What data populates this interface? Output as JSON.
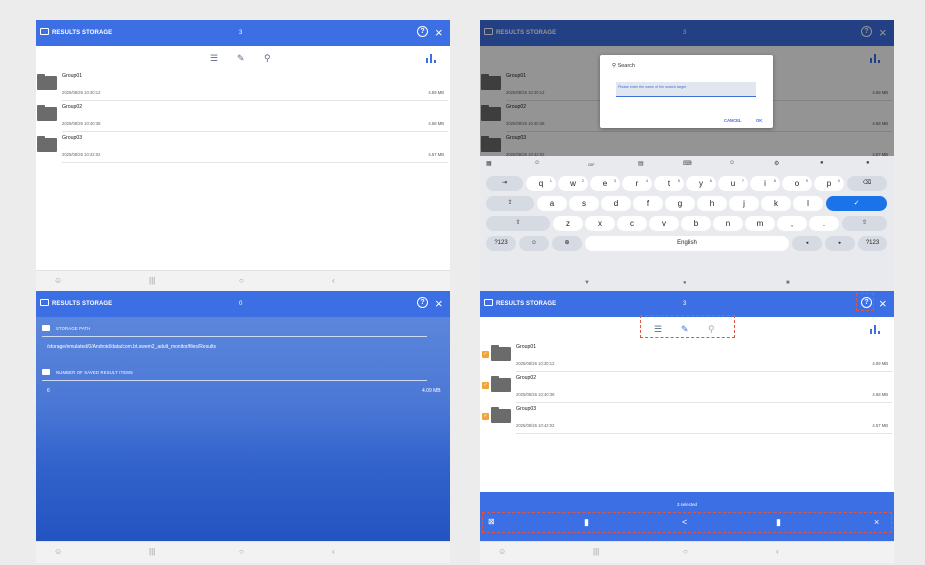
{
  "app": {
    "title": "RESULTS STORAGE",
    "help": "?",
    "close": "×"
  },
  "list_panel": {
    "count": "3",
    "groups": [
      {
        "name": "Group01",
        "date": "2025/08/26 10:30:12",
        "size": "4.59 MB"
      },
      {
        "name": "Group02",
        "date": "2025/08/26 10:40:38",
        "size": "4.58 MB"
      },
      {
        "name": "Group03",
        "date": "2025/08/26 10:42:02",
        "size": "4.57 MB"
      }
    ]
  },
  "search_panel": {
    "count": "3",
    "dialog": {
      "title": "Search",
      "placeholder": "Please enter the name of the search target",
      "cancel": "CANCEL",
      "ok": "OK"
    },
    "groups": [
      {
        "name": "Group01",
        "date": "2025/08/26 10:30:12",
        "size": "4.59 MB"
      },
      {
        "name": "Group02",
        "date": "2025/08/26 10:40:38",
        "size": "4.58 MB"
      },
      {
        "name": "Group03",
        "date": "2025/08/26 10:42:02",
        "size": "4.57 MB"
      }
    ],
    "keyboard": {
      "gif": "GIF",
      "row1": [
        [
          "q",
          "1"
        ],
        [
          "w",
          "2"
        ],
        [
          "e",
          "3"
        ],
        [
          "r",
          "4"
        ],
        [
          "t",
          "5"
        ],
        [
          "y",
          "6"
        ],
        [
          "u",
          "7"
        ],
        [
          "i",
          "8"
        ],
        [
          "o",
          "9"
        ],
        [
          "p",
          "0"
        ]
      ],
      "row2": [
        "a",
        "s",
        "d",
        "f",
        "g",
        "h",
        "j",
        "k",
        "l"
      ],
      "row3": [
        "z",
        "x",
        "c",
        "v",
        "b",
        "n",
        "m",
        ",",
        "."
      ],
      "sym": "?123",
      "space": "English"
    }
  },
  "info_panel": {
    "count": "0",
    "storage_path_label": "STORAGE PATH",
    "storage_path": "/storage/emulated/0/Android/data/com.bt.swem2_adult_monitor/files/Results",
    "saved_items_label": "NUMBER OF SAVED RESULT ITEMS",
    "saved_items": "6",
    "total_size": "4.09 MB"
  },
  "select_panel": {
    "count": "3",
    "selected_text": "3 selected",
    "groups": [
      {
        "name": "Group01",
        "date": "2025/08/26 10:30:12",
        "size": "4.59 MB"
      },
      {
        "name": "Group02",
        "date": "2025/08/26 10:40:38",
        "size": "4.58 MB"
      },
      {
        "name": "Group03",
        "date": "2025/08/26 10:42:02",
        "size": "4.57 MB"
      }
    ]
  },
  "colors": {
    "appbar": "#3d6fe4",
    "highlight": "#e0553f",
    "checkbox": "#f2a33a"
  }
}
